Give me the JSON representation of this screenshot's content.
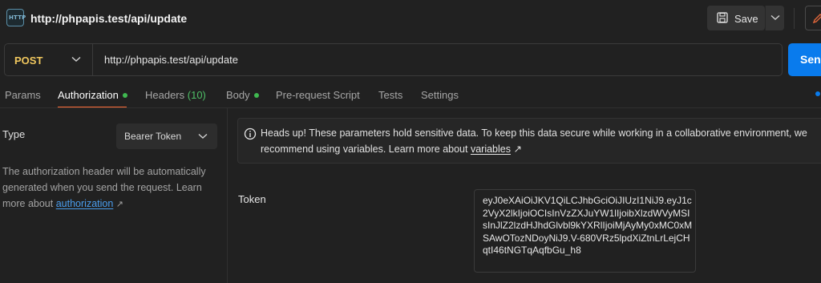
{
  "request": {
    "title": "http://phpapis.test/api/update",
    "icon_text": "HTTP",
    "save_label": "Save",
    "method": "POST",
    "url": "http://phpapis.test/api/update",
    "send_label": "Send"
  },
  "tabs": [
    {
      "label": "Params"
    },
    {
      "label": "Authorization"
    },
    {
      "label": "Headers",
      "count": "(10)"
    },
    {
      "label": "Body"
    },
    {
      "label": "Pre-request Script"
    },
    {
      "label": "Tests"
    },
    {
      "label": "Settings"
    }
  ],
  "auth": {
    "type_label": "Type",
    "type_value": "Bearer Token",
    "description": "The authorization header will be automatically generated when you send the request. Learn more about",
    "link_text": "authorization",
    "link_arrow": "↗"
  },
  "notice": {
    "text": "Heads up! These parameters hold sensitive data. To keep this data secure while working in a collaborative environment, we recommend using variables. Learn more about",
    "link_text": "variables",
    "link_arrow": "↗"
  },
  "token": {
    "label": "Token",
    "value": "eyJ0eXAiOiJKV1QiLCJhbGciOiJIUzI1NiJ9.eyJ1c2VyX2lkIjoiOCIsInVzZXJuYW1lIjoibXlzdWVyMSIsInJlZ2lzdHJhdGlvbl9kYXRlIjoiMjAyMy0xMC0xMSAwOTozNDoyNiJ9.V-680VRz5lpdXiZtnLrLejCHqtI46tNGTqAqfbGu_h8"
  },
  "colors": {
    "method": "#f0c75e",
    "send": "#097bed",
    "active_tab_underline": "#ff6c37",
    "status_dot": "#3fb950",
    "link": "#4a9eef"
  }
}
